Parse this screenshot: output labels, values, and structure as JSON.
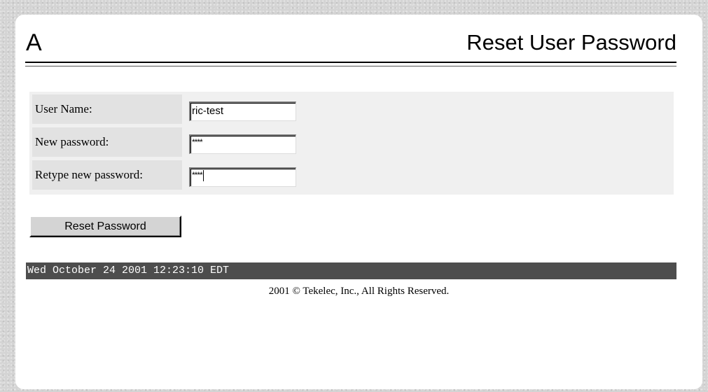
{
  "header": {
    "app_letter": "A",
    "title": "Reset User Password"
  },
  "form": {
    "fields": [
      {
        "label": "User Name:",
        "value": "ric-test",
        "type": "text"
      },
      {
        "label": "New password:",
        "value": "****",
        "type": "password"
      },
      {
        "label": "Retype new password:",
        "value": "****",
        "type": "password"
      }
    ],
    "submit_label": "Reset Password"
  },
  "status": {
    "timestamp": "Wed October 24 2001 12:23:10 EDT"
  },
  "footer": {
    "copyright": "2001 © Tekelec, Inc., All Rights Reserved."
  },
  "colors": {
    "page_background": "#d4d4d4",
    "panel": "#ffffff",
    "form_background": "#f0f0f0",
    "label_cell": "#e2e2e2",
    "status_bar": "#4d4d4d"
  }
}
